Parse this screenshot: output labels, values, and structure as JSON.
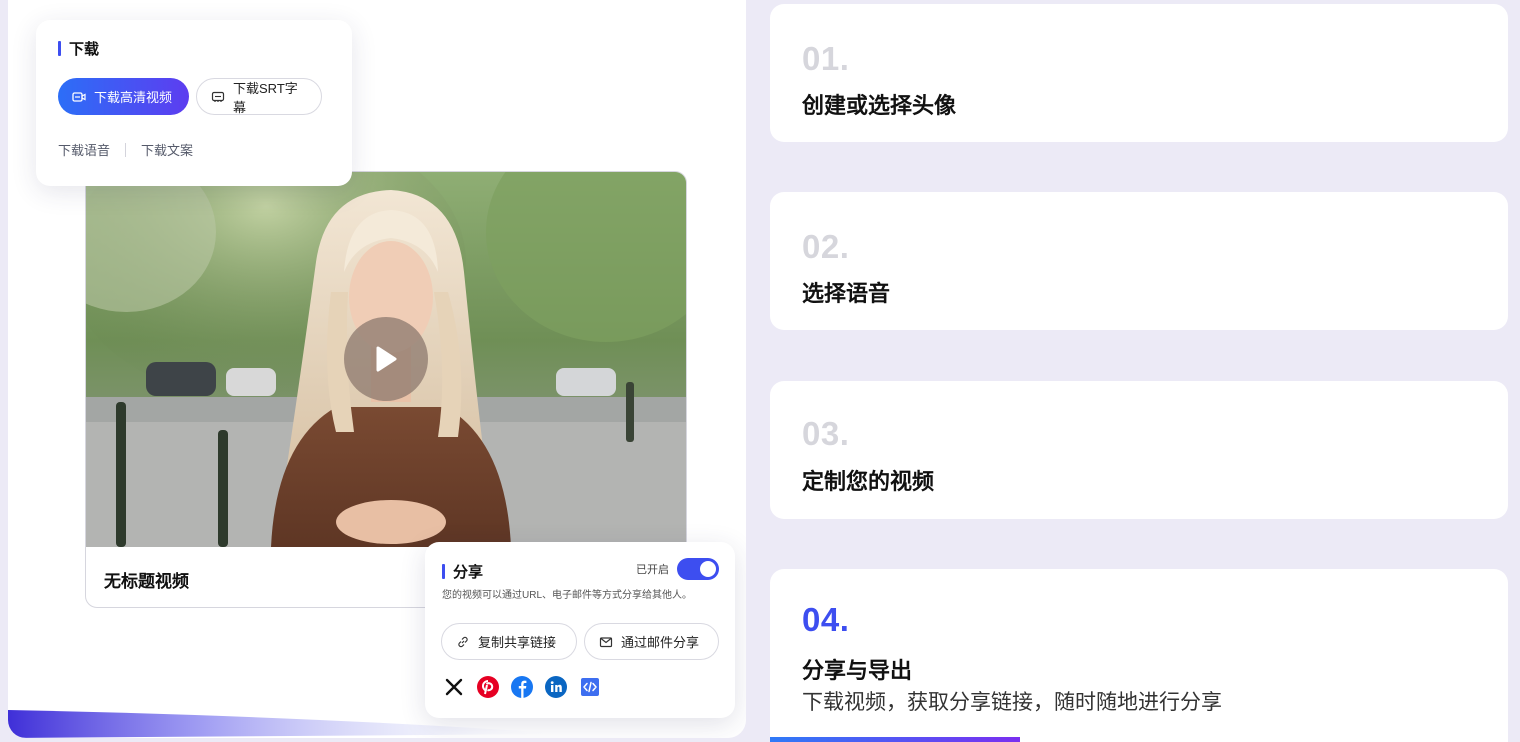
{
  "download": {
    "title": "下载",
    "hd_button": "下载高清视频",
    "srt_button": "下载SRT字幕",
    "audio_link": "下载语音",
    "script_link": "下载文案"
  },
  "video": {
    "title": "无标题视频"
  },
  "share": {
    "title": "分享",
    "toggle_label": "已开启",
    "toggle_on": true,
    "description": "您的视频可以通过URL、电子邮件等方式分享给其他人。",
    "copy_link_button": "复制共享链接",
    "email_button": "通过邮件分享",
    "social_icons": [
      "x-icon",
      "pinterest-icon",
      "facebook-icon",
      "linkedin-icon",
      "embed-code-icon"
    ]
  },
  "steps": [
    {
      "number": "01.",
      "title": "创建或选择头像"
    },
    {
      "number": "02.",
      "title": "选择语音"
    },
    {
      "number": "03.",
      "title": "定制您的视频"
    },
    {
      "number": "04.",
      "title": "分享与导出",
      "description": "下载视频，获取分享链接，随时随地进行分享",
      "active": true
    }
  ],
  "colors": {
    "accent": "#3d4ef0",
    "page_background": "#eceaf6",
    "step_number_inactive": "#d6d6dc",
    "pinterest": "#e60023",
    "facebook": "#1877f2",
    "linkedin": "#0a66c2"
  }
}
